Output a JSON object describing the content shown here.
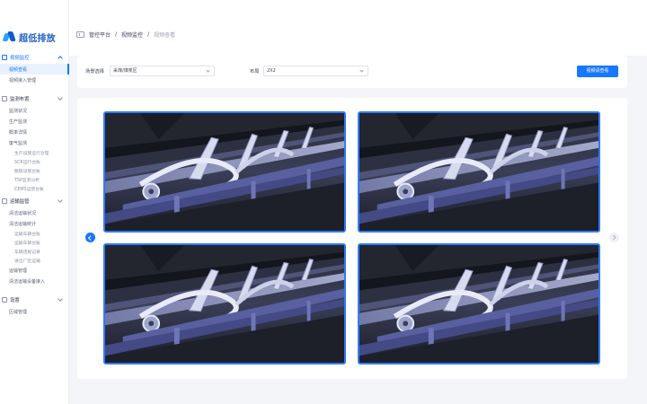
{
  "brand": {
    "name": "超低排放"
  },
  "breadcrumb": {
    "root": "管控平台",
    "sep": "/",
    "section": "视频监控",
    "page": "视频查看"
  },
  "sidebar": {
    "groups": [
      {
        "label": "视频监控",
        "active": true,
        "expanded": true,
        "items": [
          {
            "label": "视频查看",
            "selected": true
          },
          {
            "label": "视频接入管理"
          }
        ]
      },
      {
        "label": "监测布置",
        "expanded": true,
        "items": [
          {
            "label": "监测状况"
          },
          {
            "label": "生产监测"
          },
          {
            "label": "概率详情"
          },
          {
            "label": "废气监测"
          }
        ],
        "subitems": [
          "生产设施运行治理",
          "SCR运行台账",
          "脱硫设施台账",
          "TSP监测分析",
          "CEMS运营台账"
        ]
      },
      {
        "label": "运输监管",
        "expanded": true,
        "items": [
          {
            "label": "清洁运输状况"
          },
          {
            "label": "清洁运输统计"
          }
        ],
        "subitems": [
          "运输车辆台账",
          "运输车辆台账",
          "车辆违规记录",
          "进出厂区运输"
        ],
        "items_after": [
          {
            "label": "运输管理"
          },
          {
            "label": "清洁运输设备接入"
          }
        ]
      },
      {
        "label": "设置",
        "expanded": true,
        "items": [
          {
            "label": "区域管理"
          }
        ]
      }
    ]
  },
  "filter": {
    "scene_label": "场景选择",
    "scene_value": "采煤/煤炭区",
    "layout_label": "布局",
    "layout_value": "2X2",
    "submit_label": "视频请查看"
  },
  "videos": [
    {
      "name": "camera-1"
    },
    {
      "name": "camera-2"
    },
    {
      "name": "camera-3"
    },
    {
      "name": "camera-4"
    }
  ],
  "colors": {
    "accent": "#1677ff",
    "tile_border": "#2f7cf6"
  }
}
